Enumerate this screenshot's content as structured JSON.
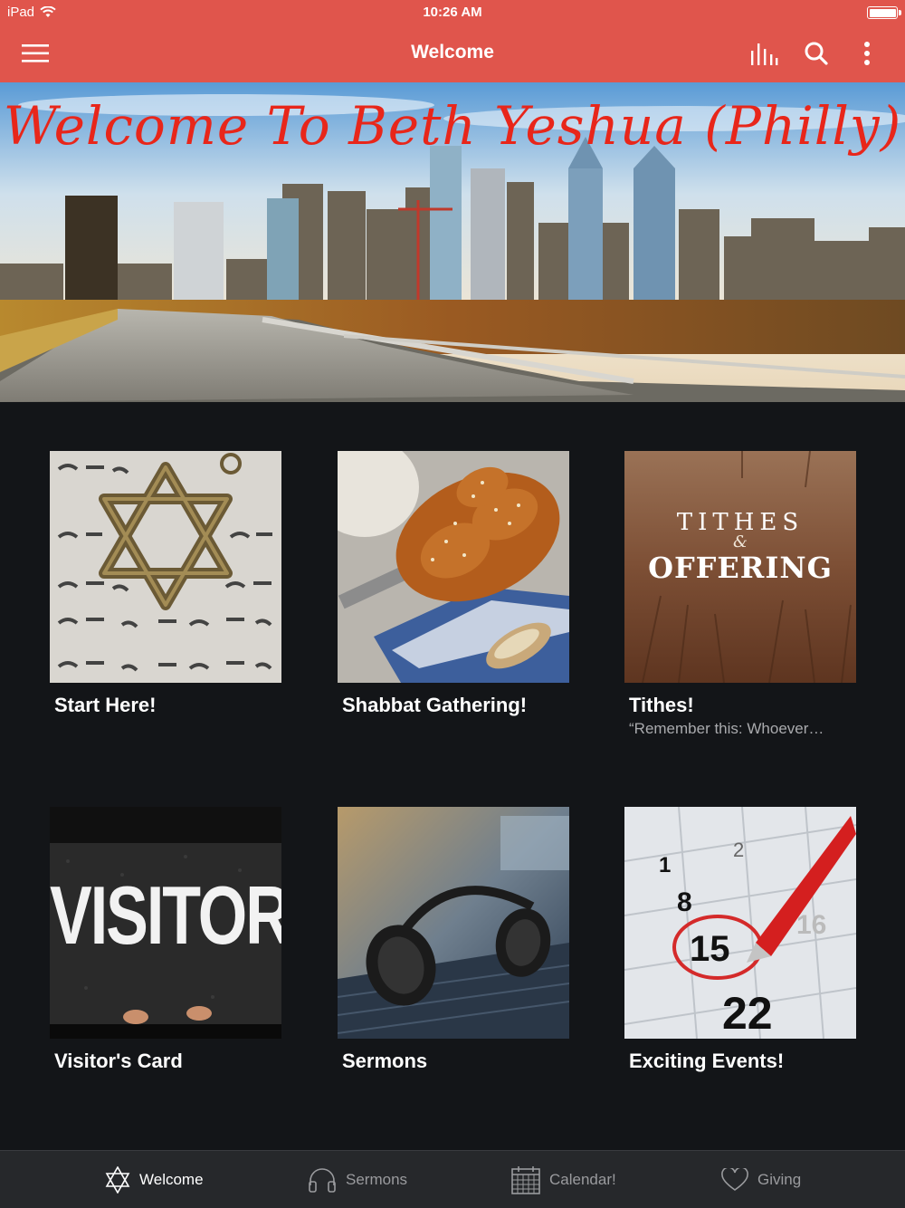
{
  "status_bar": {
    "device": "iPad",
    "time": "10:26 AM"
  },
  "nav": {
    "title": "Welcome",
    "menu_icon": "hamburger-icon",
    "actions": [
      "equalizer-icon",
      "search-icon",
      "more-vertical-icon"
    ]
  },
  "hero": {
    "title": "Welcome To Beth Yeshua (Philly)"
  },
  "tiles": [
    {
      "title": "Start Here!",
      "subtitle": "",
      "image": "star-of-david-hebrew-text"
    },
    {
      "title": "Shabbat Gathering!",
      "subtitle": "",
      "image": "challah-bread"
    },
    {
      "title": "Tithes!",
      "subtitle": "“Remember this: Whoever…",
      "image": "tithes-offering-wheat",
      "image_text": [
        "TITHES",
        "&",
        "OFFERING"
      ]
    },
    {
      "title": "Visitor's Card",
      "subtitle": "",
      "image": "visitor-stencil-pavement",
      "image_text": [
        "VISITOR"
      ]
    },
    {
      "title": "Sermons",
      "subtitle": "",
      "image": "headphones-laptop"
    },
    {
      "title": "Exciting Events!",
      "subtitle": "",
      "image": "calendar-red-pen",
      "image_text": [
        "1",
        "2",
        "8",
        "15",
        "16",
        "22"
      ]
    }
  ],
  "tabs": [
    {
      "label": "Welcome",
      "icon": "star-of-david-icon",
      "active": true
    },
    {
      "label": "Sermons",
      "icon": "headphones-icon",
      "active": false
    },
    {
      "label": "Calendar!",
      "icon": "calendar-icon",
      "active": false
    },
    {
      "label": "Giving",
      "icon": "heart-icon",
      "active": false
    }
  ],
  "colors": {
    "header": "#e0554c",
    "background": "#131518",
    "tabbar": "#26282b",
    "hero_title": "#e8261a"
  }
}
